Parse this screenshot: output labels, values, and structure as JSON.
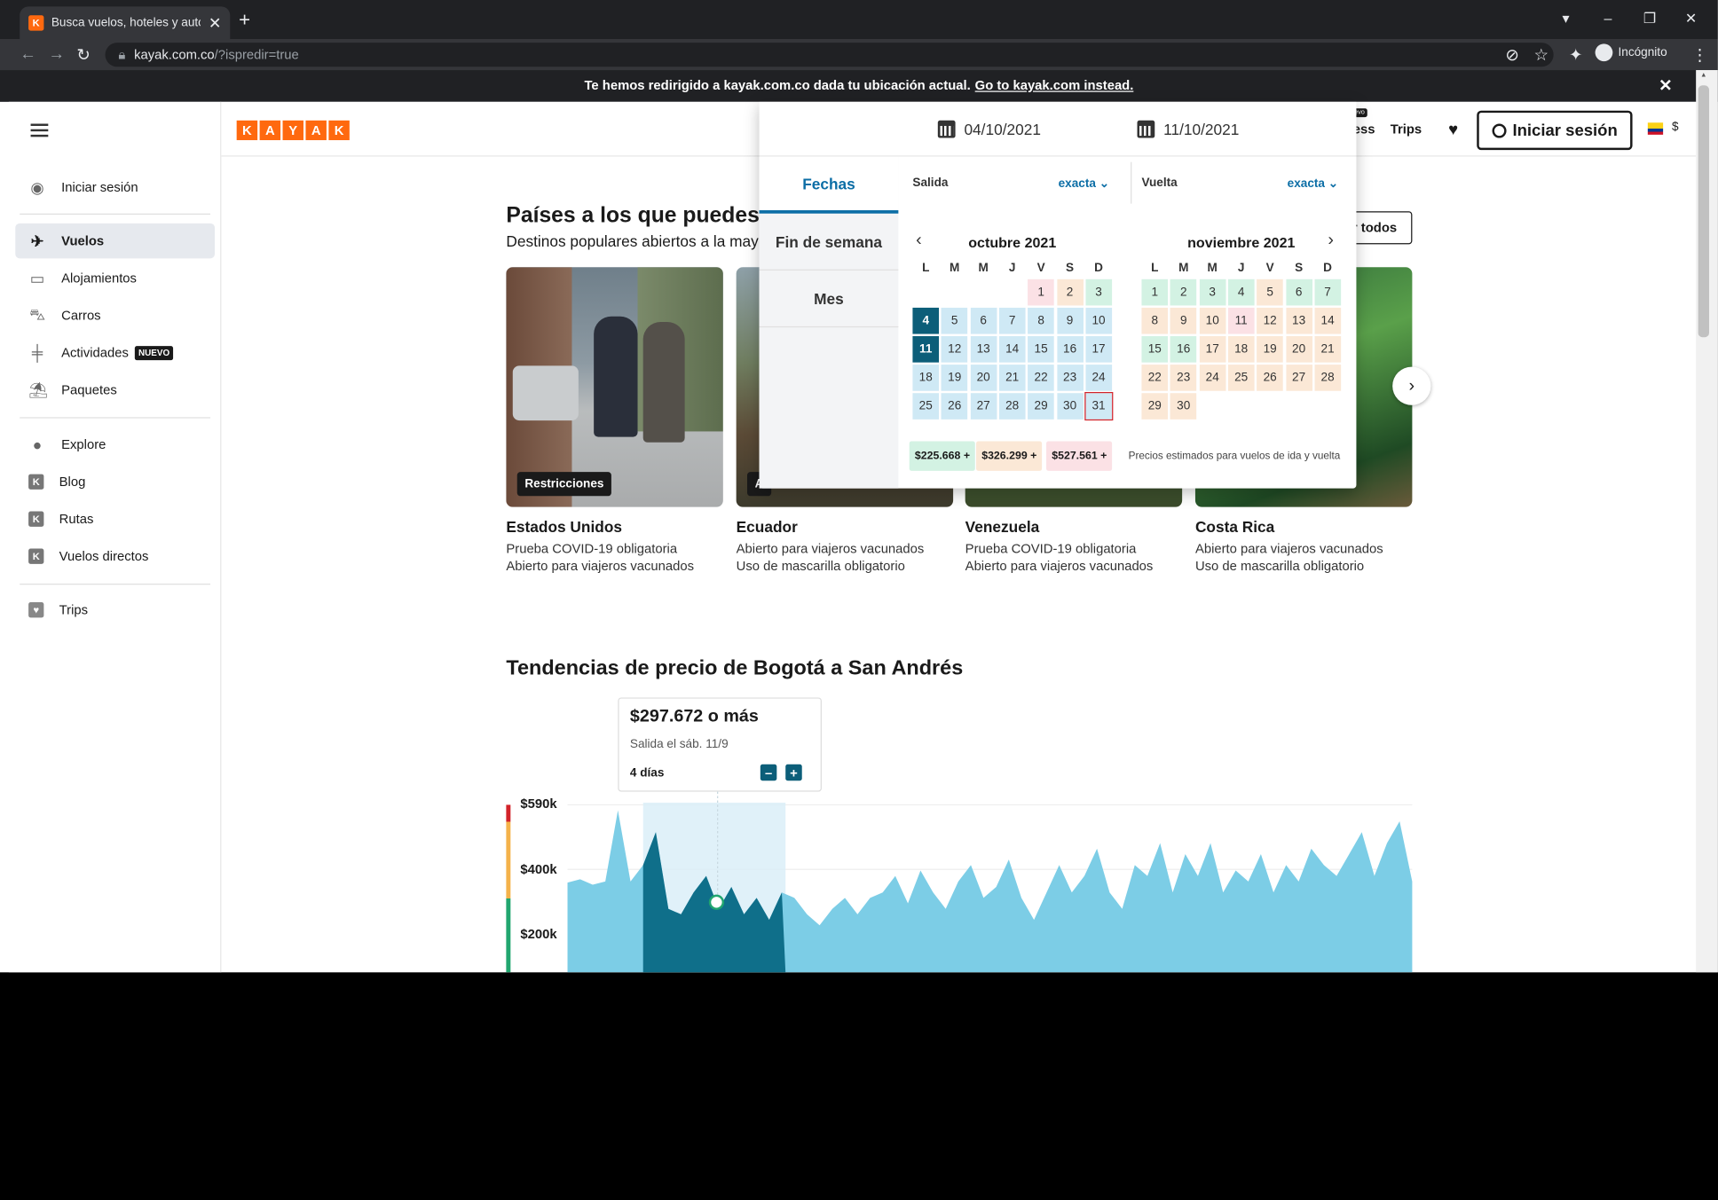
{
  "browser": {
    "tab_title": "Busca vuelos, hoteles y autos de",
    "tab_icon": "K",
    "url_host": "kayak.com.co",
    "url_path": "/?ispredir=true",
    "profile_label": "Incógnito"
  },
  "banner": {
    "text": "Te hemos redirigido a kayak.com.co dada tu ubicación actual.",
    "link": "Go to kayak.com instead."
  },
  "sidebar": {
    "login": "Iniciar sesión",
    "items": [
      "Vuelos",
      "Alojamientos",
      "Carros",
      "Actividades",
      "Paquetes"
    ],
    "nuevo_badge": "NUEVO",
    "more": [
      "Explore",
      "Blog",
      "Rutas",
      "Vuelos directos"
    ],
    "trips": "Trips"
  },
  "header": {
    "logo": [
      "K",
      "A",
      "Y",
      "A",
      "K"
    ],
    "business": "ess",
    "nuevo_tag": "evo",
    "trips": "Trips",
    "login": "Iniciar sesión",
    "currency": "$"
  },
  "destinations": {
    "title": "Países a los que puedes",
    "subtitle": "Destinos populares abiertos a la mayoría",
    "see_all": "r todos",
    "cards": [
      {
        "badge": "Restricciones",
        "name": "Estados Unidos",
        "lines": [
          "Prueba COVID-19 obligatoria",
          "Abierto para viajeros vacunados"
        ]
      },
      {
        "badge": "A",
        "name": "Ecuador",
        "lines": [
          "Abierto para viajeros vacunados",
          "Uso de mascarilla obligatorio"
        ]
      },
      {
        "badge": "",
        "name": "Venezuela",
        "lines": [
          "Prueba COVID-19 obligatoria",
          "Abierto para viajeros vacunados"
        ]
      },
      {
        "badge": "",
        "name": "Costa Rica",
        "lines": [
          "Abierto para viajeros vacunados",
          "Uso de mascarilla obligatorio"
        ]
      }
    ]
  },
  "trends": {
    "title": "Tendencias de precio de Bogotá a San Andrés",
    "tooltip_price": "$297.672 o más",
    "tooltip_date": "Salida el sáb. 11/9",
    "tooltip_days": "4 días",
    "minus": "–",
    "plus": "+",
    "y_labels": [
      "$590k",
      "$400k",
      "$200k"
    ]
  },
  "chart_data": {
    "type": "area",
    "title": "Tendencias de precio de Bogotá a San Andrés",
    "y_ticks": [
      "$590k",
      "$400k",
      "$200k"
    ],
    "highlight": {
      "price": "$297.672",
      "date": "sáb. 11/9"
    }
  },
  "datepicker": {
    "depart": "04/10/2021",
    "return": "11/10/2021",
    "tabs": [
      "Fechas",
      "Fin de semana",
      "Mes"
    ],
    "salida": "Salida",
    "vuelta": "Vuelta",
    "flex": "exacta",
    "dow": [
      "L",
      "M",
      "M",
      "J",
      "V",
      "S",
      "D"
    ],
    "months": [
      {
        "name": "octubre 2021",
        "offset": 4,
        "days": 31,
        "colors": "rogbbbbbbbbbbbbbbbbbbbbbbbbbbbb"
      },
      {
        "name": "noviembre 2021",
        "offset": 0,
        "days": 30,
        "colors": "ggggoggoooroooggoooooooooooooooo"
      }
    ],
    "legend": [
      "$225.668 +",
      "$326.299 +",
      "$527.561 +"
    ],
    "legend_note": "Precios estimados para vuelos de ida y vuelta"
  }
}
